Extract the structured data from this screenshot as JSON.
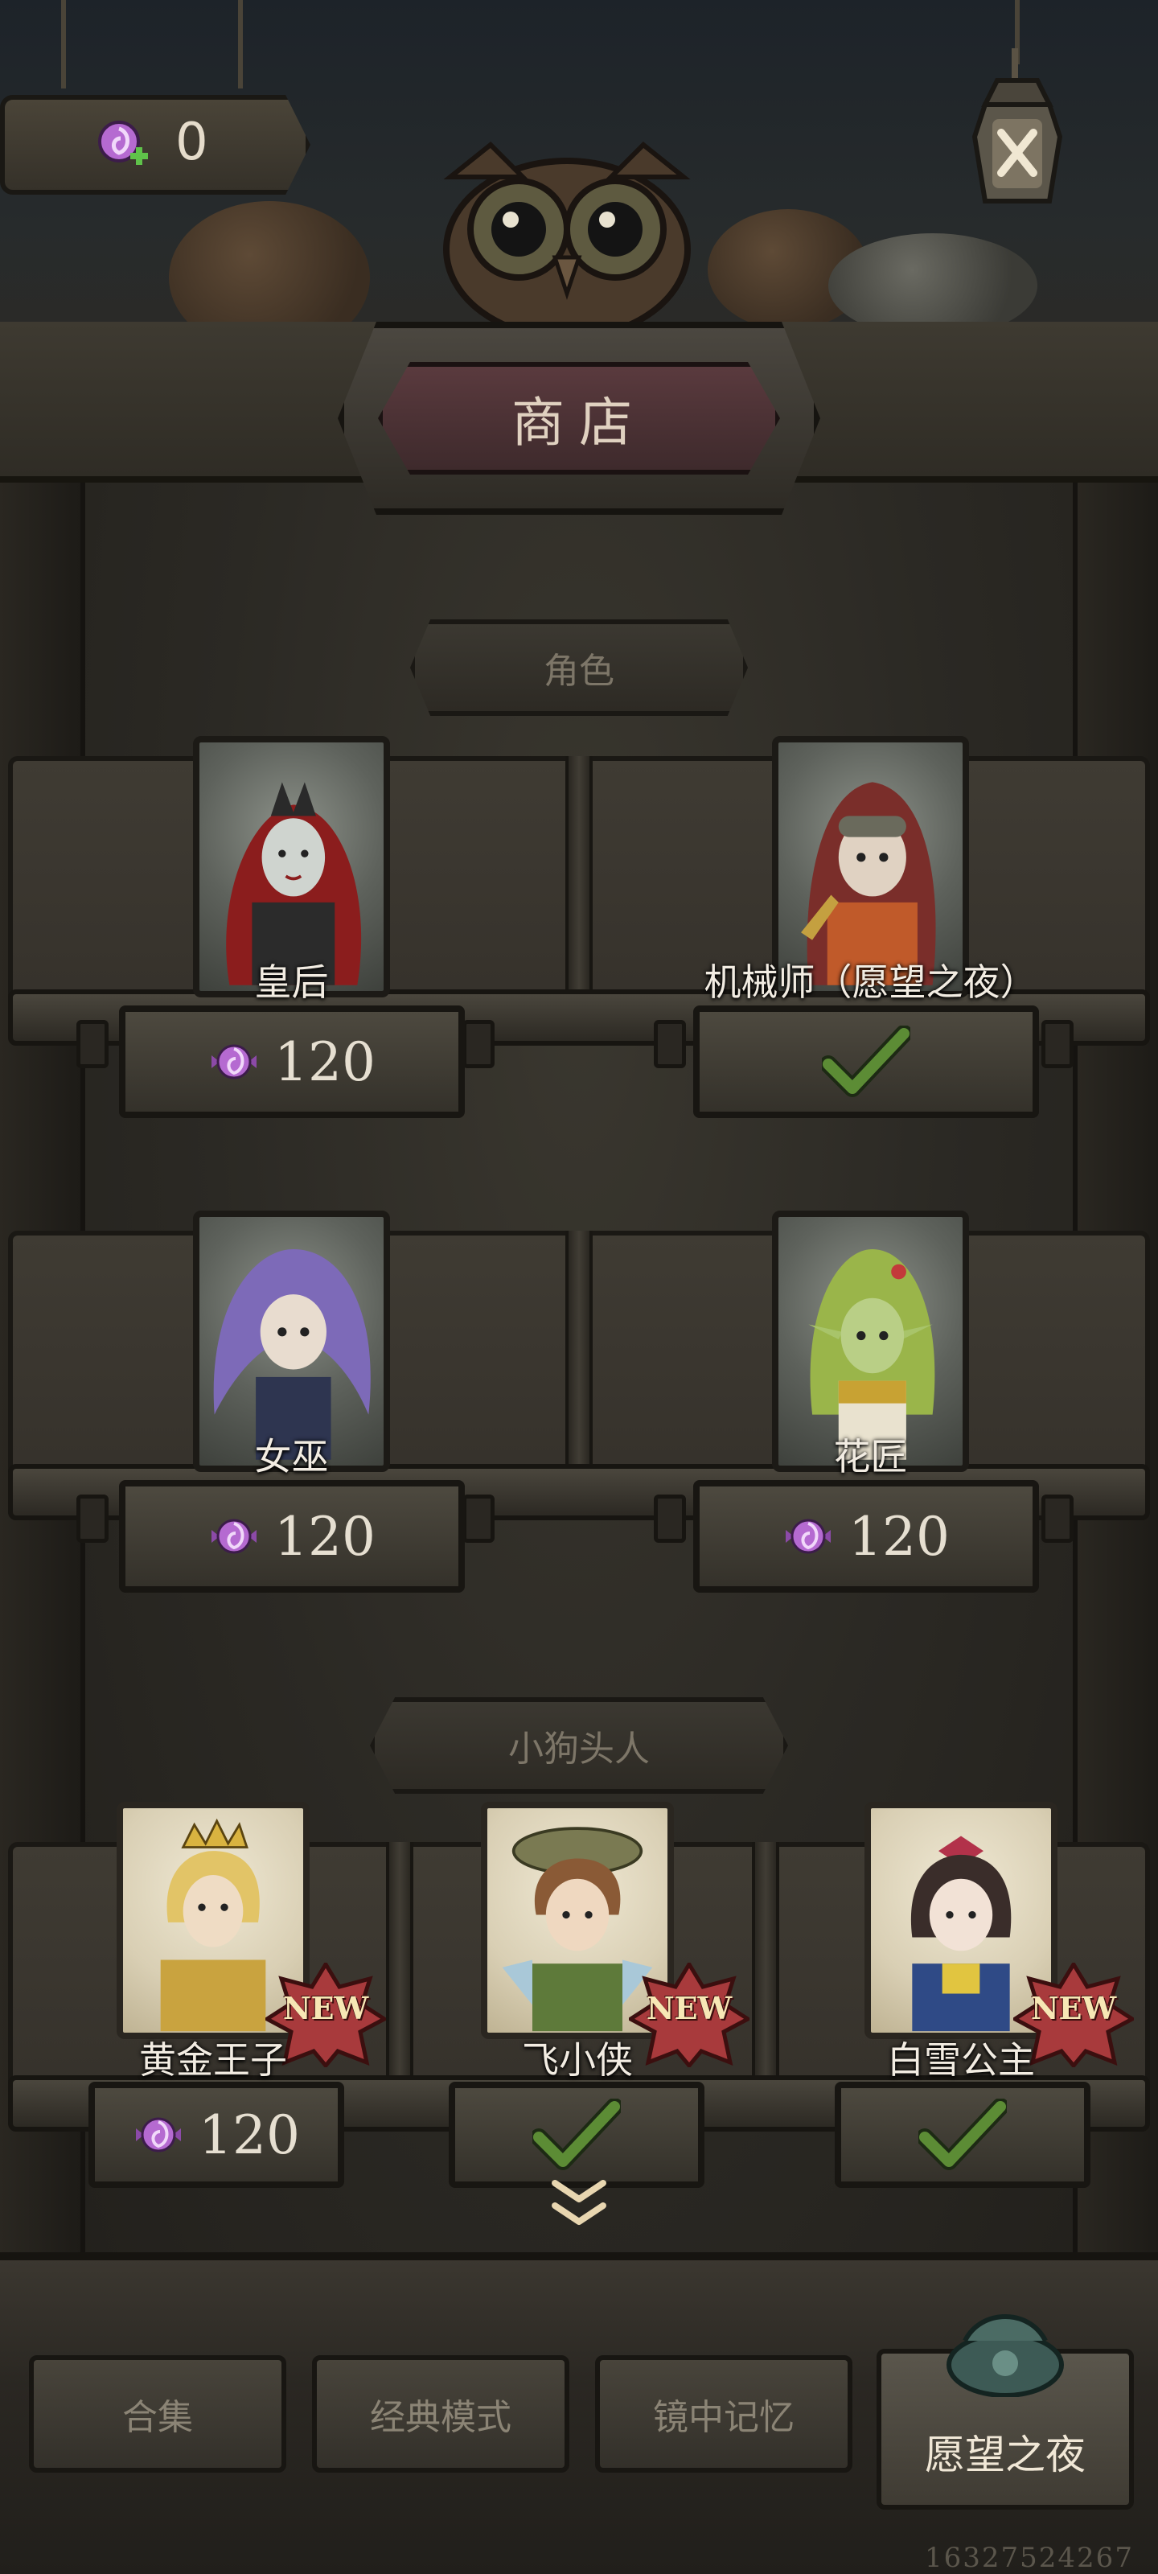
{
  "currency": {
    "amount": "0",
    "icon": "candy-plus-icon"
  },
  "close": {
    "icon": "close-icon"
  },
  "title": "商店",
  "sections": [
    {
      "label": "角色",
      "items": [
        {
          "name": "皇后",
          "price": "120",
          "owned": false,
          "new": false
        },
        {
          "name": "机械师（愿望之夜）",
          "price": "",
          "owned": true,
          "new": false
        },
        {
          "name": "女巫",
          "price": "120",
          "owned": false,
          "new": false
        },
        {
          "name": "花匠",
          "price": "120",
          "owned": false,
          "new": false
        }
      ]
    },
    {
      "label": "小狗头人",
      "items": [
        {
          "name": "黄金王子",
          "price": "120",
          "owned": false,
          "new": true,
          "badge": "NEW"
        },
        {
          "name": "飞小侠",
          "price": "",
          "owned": true,
          "new": true,
          "badge": "NEW"
        },
        {
          "name": "白雪公主",
          "price": "",
          "owned": true,
          "new": true,
          "badge": "NEW"
        }
      ]
    }
  ],
  "tabs": [
    {
      "label": "合集",
      "active": false
    },
    {
      "label": "经典模式",
      "active": false
    },
    {
      "label": "镜中记忆",
      "active": false
    },
    {
      "label": "愿望之夜",
      "active": true
    }
  ],
  "build_id": "16327524267",
  "colors": {
    "candy": "#b56ad1",
    "check": "#4d7a2c",
    "new_badge": "#a83a3c"
  }
}
